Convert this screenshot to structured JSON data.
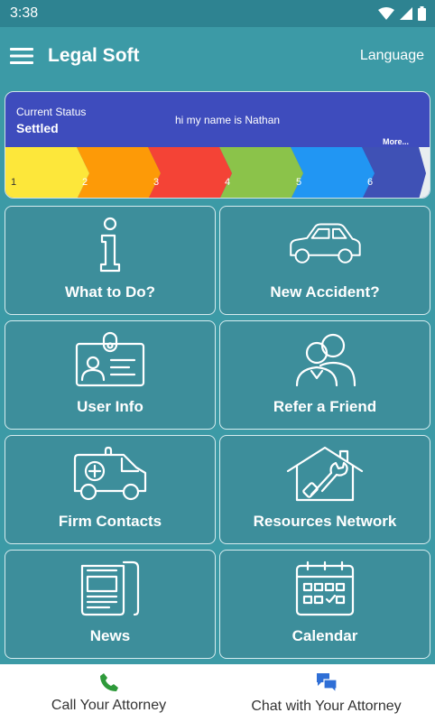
{
  "status_bar": {
    "time": "3:38"
  },
  "app_bar": {
    "title": "Legal Soft",
    "language_label": "Language"
  },
  "status_card": {
    "label": "Current Status",
    "value": "Settled",
    "greeting": "hi my name is Nathan",
    "more_label": "More...",
    "steps": [
      "1",
      "2",
      "3",
      "4",
      "5",
      "6"
    ],
    "step_colors": [
      "#fde73a",
      "#fd9a07",
      "#f44336",
      "#8bc34a",
      "#2196f3",
      "#3f51b5"
    ]
  },
  "tiles": [
    {
      "label": "What to Do?",
      "icon": "info-icon"
    },
    {
      "label": "New Accident?",
      "icon": "car-icon"
    },
    {
      "label": "User Info",
      "icon": "id-badge-icon"
    },
    {
      "label": "Refer a Friend",
      "icon": "people-icon"
    },
    {
      "label": "Firm Contacts",
      "icon": "ambulance-icon"
    },
    {
      "label": "Resources Network",
      "icon": "house-tools-icon"
    },
    {
      "label": "News",
      "icon": "newspaper-icon"
    },
    {
      "label": "Calendar",
      "icon": "calendar-icon"
    }
  ],
  "bottom_bar": {
    "call_label": "Call Your Attorney",
    "chat_label": "Chat with Your Attorney",
    "call_icon_color": "#2e9a3a",
    "chat_icon_color": "#2f6fd6"
  }
}
